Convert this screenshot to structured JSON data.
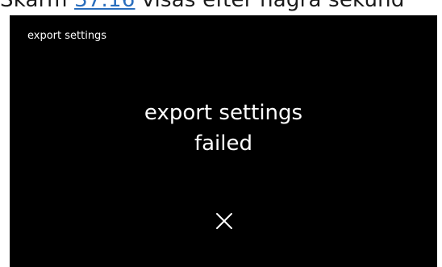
{
  "caption": {
    "before": "Skärm ",
    "link": "37.16",
    "after": " visas efter några sekund"
  },
  "screen": {
    "header_title": "export settings",
    "message_line1": "export settings",
    "message_line2": "failed",
    "close_icon": "close-icon",
    "colors": {
      "background": "#000000",
      "text": "#ffffff"
    }
  }
}
